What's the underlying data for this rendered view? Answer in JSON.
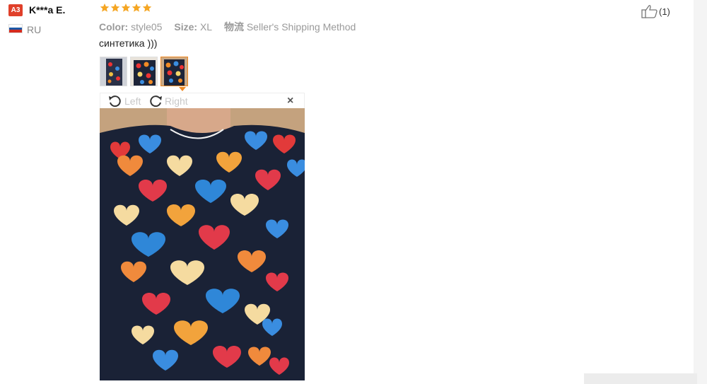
{
  "reviewer": {
    "badge": "A3",
    "name": "K***a E.",
    "country": "RU"
  },
  "review": {
    "rating": 5,
    "rating_max": 5,
    "color_label": "Color:",
    "color_value": "style05",
    "size_label": "Size:",
    "size_value": "XL",
    "shipping_label": "物流",
    "shipping_value": "Seller's Shipping Method",
    "text": "синтетика )))"
  },
  "viewer": {
    "rotate_left_label": "Left",
    "rotate_right_label": "Right",
    "close_symbol": "×",
    "selected_thumbnail": 3
  },
  "helpful": {
    "count": "(1)"
  },
  "colors": {
    "star": "#f5a623",
    "badge": "#e0402a",
    "active_border": "#f08a24",
    "shirt": "#1a2236"
  }
}
